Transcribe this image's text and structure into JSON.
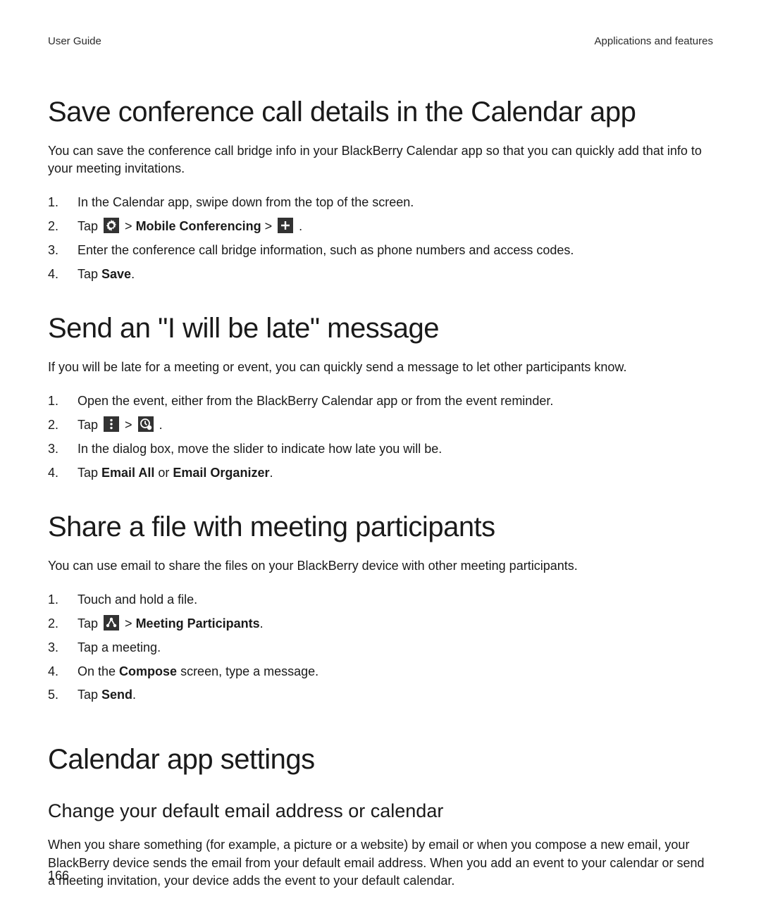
{
  "header": {
    "left": "User Guide",
    "right": "Applications and features"
  },
  "page_number": "166",
  "sec1": {
    "title": "Save conference call details in the Calendar app",
    "intro": "You can save the conference call bridge info in your BlackBerry Calendar app so that you can quickly add that info to your meeting invitations.",
    "s1": "In the Calendar app, swipe down from the top of the screen.",
    "s2_tap": "Tap ",
    "s2_mc": "Mobile Conferencing",
    "s2_gt": " > ",
    "s2_end": " .",
    "s3": "Enter the conference call bridge information, such as phone numbers and access codes.",
    "s4_a": "Tap ",
    "s4_b": "Save",
    "s4_c": "."
  },
  "sec2": {
    "title": "Send an \"I will be late\" message",
    "intro": "If you will be late for a meeting or event, you can quickly send a message to let other participants know.",
    "s1": "Open the event, either from the BlackBerry Calendar app or from the event reminder.",
    "s2_tap": "Tap ",
    "s2_gt": " > ",
    "s2_end": " .",
    "s3": "In the dialog box, move the slider to indicate how late you will be.",
    "s4_a": "Tap ",
    "s4_b": "Email All",
    "s4_c": " or ",
    "s4_d": "Email Organizer",
    "s4_e": "."
  },
  "sec3": {
    "title": "Share a file with meeting participants",
    "intro": "You can use email to share the files on your BlackBerry device with other meeting participants.",
    "s1": "Touch and hold a file.",
    "s2_tap": "Tap ",
    "s2_gt": " > ",
    "s2_mp": "Meeting Participants",
    "s2_end": ".",
    "s3": "Tap a meeting.",
    "s4_a": "On the ",
    "s4_b": "Compose",
    "s4_c": " screen, type a message.",
    "s5_a": "Tap ",
    "s5_b": "Send",
    "s5_c": "."
  },
  "sec4": {
    "title": "Calendar app settings",
    "sub": "Change your default email address or calendar",
    "body": "When you share something (for example, a picture or a website) by email or when you compose a new email, your BlackBerry device sends the email from your default email address. When you add an event to your calendar or send a meeting invitation, your device adds the event to your default calendar."
  }
}
